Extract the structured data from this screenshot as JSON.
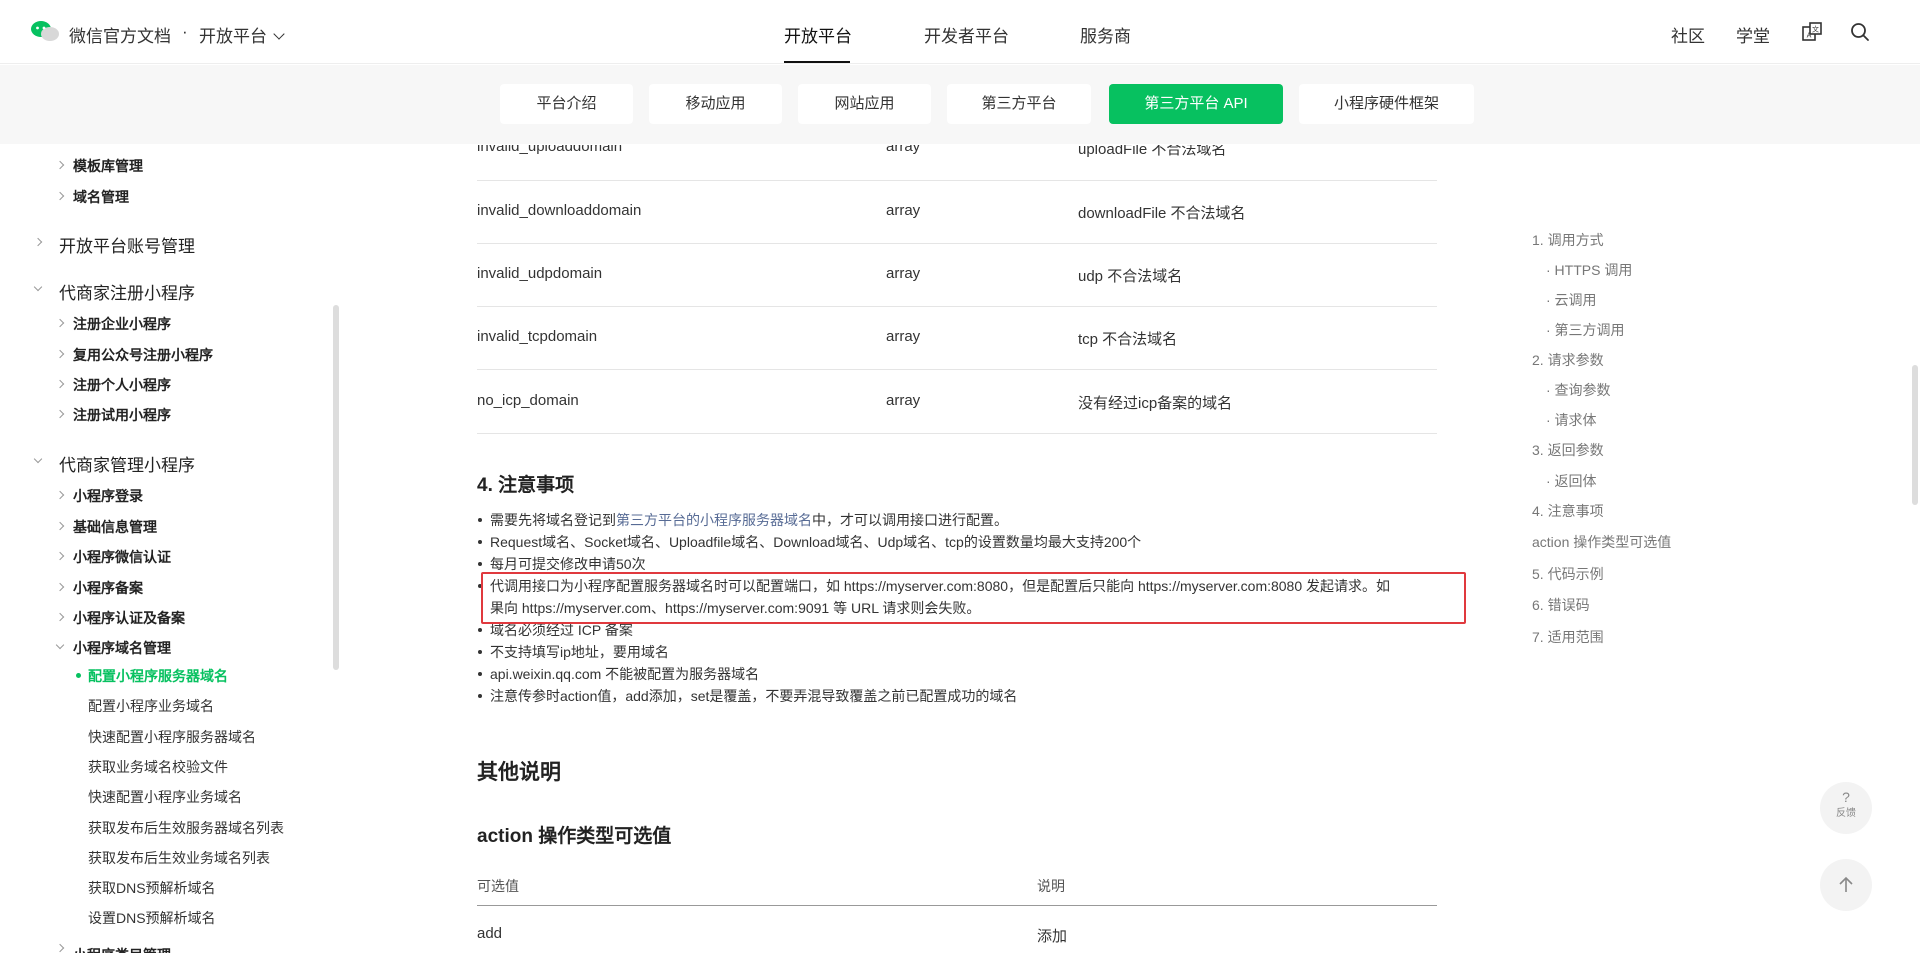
{
  "header": {
    "site_title": "微信官方文档",
    "separator": "·",
    "platform_switch": "开放平台",
    "nav": [
      "开放平台",
      "开发者平台",
      "服务商"
    ],
    "right_links": [
      "社区",
      "学堂"
    ]
  },
  "subnav": {
    "tabs": [
      "平台介绍",
      "移动应用",
      "网站应用",
      "第三方平台",
      "第三方平台 API",
      "小程序硬件框架"
    ]
  },
  "sidebar": {
    "items": [
      "模板库管理",
      "域名管理",
      "开放平台账号管理",
      "代商家注册小程序",
      "注册企业小程序",
      "复用公众号注册小程序",
      "注册个人小程序",
      "注册试用小程序",
      "代商家管理小程序",
      "小程序登录",
      "基础信息管理",
      "小程序微信认证",
      "小程序备案",
      "小程序认证及备案",
      "小程序域名管理",
      "配置小程序服务器域名",
      "配置小程序业务域名",
      "快速配置小程序服务器域名",
      "获取业务域名校验文件",
      "快速配置小程序业务域名",
      "获取发布后生效服务器域名列表",
      "获取发布后生效业务域名列表",
      "获取DNS预解析域名",
      "设置DNS预解析域名",
      "小程序类目管理"
    ]
  },
  "content": {
    "table_rows": [
      {
        "name": "invalid_uploaddomain",
        "type": "array",
        "desc": "uploadFile 不合法域名"
      },
      {
        "name": "invalid_downloaddomain",
        "type": "array",
        "desc": "downloadFile 不合法域名"
      },
      {
        "name": "invalid_udpdomain",
        "type": "array",
        "desc": "udp 不合法域名"
      },
      {
        "name": "invalid_tcpdomain",
        "type": "array",
        "desc": "tcp 不合法域名"
      },
      {
        "name": "no_icp_domain",
        "type": "array",
        "desc": "没有经过icp备案的域名"
      }
    ],
    "notes_title": "4. 注意事项",
    "notes": {
      "n1_pre": "需要先将域名登记到",
      "n1_link": "第三方平台的小程序服务器域名",
      "n1_post": "中，才可以调用接口进行配置。",
      "n2": "Request域名、Socket域名、Uploadfile域名、Download域名、Udp域名、tcp的设置数量均最大支持200个",
      "n3": "每月可提交修改申请50次",
      "n4_line1": "代调用接口为小程序配置服务器域名时可以配置端口，如 https://myserver.com:8080，但是配置后只能向 https://myserver.com:8080 发起请求。如",
      "n4_line2": "果向 https://myserver.com、https://myserver.com:9091 等 URL 请求则会失败。",
      "n5": "域名必须经过 ICP 备案",
      "n6": "不支持填写ip地址，要用域名",
      "n7": "api.weixin.qq.com 不能被配置为服务器域名",
      "n8": "注意传参时action值，add添加，set是覆盖，不要弄混导致覆盖之前已配置成功的域名"
    },
    "other_title": "其他说明",
    "action_title": "action 操作类型可选值",
    "action_table": {
      "headers": [
        "可选值",
        "说明"
      ],
      "rows": [
        {
          "value": "add",
          "desc": "添加"
        }
      ]
    }
  },
  "toc": {
    "items": [
      "1. 调用方式",
      "· HTTPS 调用",
      "· 云调用",
      "· 第三方调用",
      "2. 请求参数",
      "· 查询参数",
      "· 请求体",
      "3. 返回参数",
      "· 返回体",
      "4. 注意事项",
      "action 操作类型可选值",
      "5. 代码示例",
      "6. 错误码",
      "7. 适用范围"
    ]
  },
  "floating": {
    "feedback_symbol": "?",
    "feedback_label": "反馈"
  },
  "colors": {
    "brand_green": "#07c160",
    "link": "#576b95",
    "highlight_red": "#e0393e"
  }
}
